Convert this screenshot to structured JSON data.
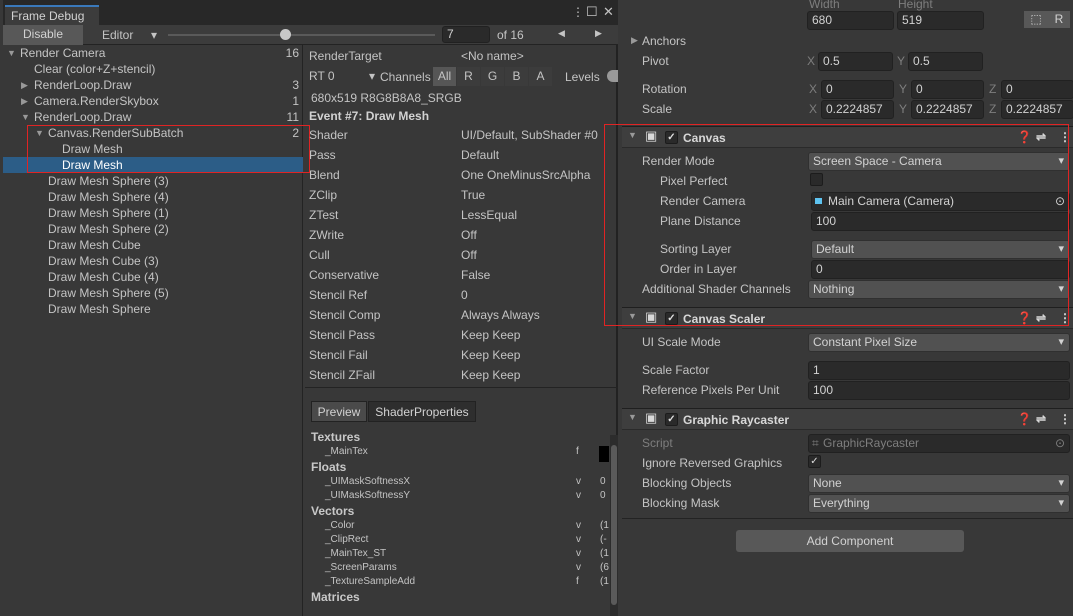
{
  "frame_debug": {
    "tab": "Frame Debug",
    "disable": "Disable",
    "target": "Editor",
    "event_index": "7",
    "of": "of 16",
    "slider_value": 7,
    "slider_max": 16,
    "tree": [
      {
        "label": "Render Camera",
        "count": "16",
        "indent": 0,
        "arrow": "▼"
      },
      {
        "label": "Clear (color+Z+stencil)",
        "count": "",
        "indent": 1,
        "arrow": ""
      },
      {
        "label": "RenderLoop.Draw",
        "count": "3",
        "indent": 1,
        "arrow": "▶"
      },
      {
        "label": "Camera.RenderSkybox",
        "count": "1",
        "indent": 1,
        "arrow": "▶"
      },
      {
        "label": "RenderLoop.Draw",
        "count": "11",
        "indent": 1,
        "arrow": "▼"
      },
      {
        "label": "Canvas.RenderSubBatch",
        "count": "2",
        "indent": 2,
        "arrow": "▼"
      },
      {
        "label": "Draw Mesh",
        "count": "",
        "indent": 3,
        "arrow": ""
      },
      {
        "label": "Draw Mesh",
        "count": "",
        "indent": 3,
        "arrow": "",
        "selected": true
      },
      {
        "label": "Draw Mesh Sphere (3)",
        "count": "",
        "indent": 2,
        "arrow": ""
      },
      {
        "label": "Draw Mesh Sphere (4)",
        "count": "",
        "indent": 2,
        "arrow": ""
      },
      {
        "label": "Draw Mesh Sphere (1)",
        "count": "",
        "indent": 2,
        "arrow": ""
      },
      {
        "label": "Draw Mesh Sphere (2)",
        "count": "",
        "indent": 2,
        "arrow": ""
      },
      {
        "label": "Draw Mesh Cube",
        "count": "",
        "indent": 2,
        "arrow": ""
      },
      {
        "label": "Draw Mesh Cube (3)",
        "count": "",
        "indent": 2,
        "arrow": ""
      },
      {
        "label": "Draw Mesh Cube (4)",
        "count": "",
        "indent": 2,
        "arrow": ""
      },
      {
        "label": "Draw Mesh Sphere (5)",
        "count": "",
        "indent": 2,
        "arrow": ""
      },
      {
        "label": "Draw Mesh Sphere",
        "count": "",
        "indent": 2,
        "arrow": ""
      }
    ],
    "render_target_label": "RenderTarget",
    "render_target": "<No name>",
    "rt": "RT 0",
    "channels": "Channels",
    "channel_buttons": [
      "All",
      "R",
      "G",
      "B",
      "A"
    ],
    "levels": "Levels",
    "format": "680x519 R8G8B8A8_SRGB",
    "event": "Event #7: Draw Mesh",
    "props": [
      [
        "Shader",
        "UI/Default, SubShader #0"
      ],
      [
        "Pass",
        "Default"
      ],
      [
        "Blend",
        "One OneMinusSrcAlpha"
      ],
      [
        "ZClip",
        "True"
      ],
      [
        "ZTest",
        "LessEqual"
      ],
      [
        "ZWrite",
        "Off"
      ],
      [
        "Cull",
        "Off"
      ],
      [
        "Conservative",
        "False"
      ],
      [
        "Stencil Ref",
        "0"
      ],
      [
        "Stencil Comp",
        "Always Always"
      ],
      [
        "Stencil Pass",
        "Keep Keep"
      ],
      [
        "Stencil Fail",
        "Keep Keep"
      ],
      [
        "Stencil ZFail",
        "Keep Keep"
      ]
    ],
    "tabs": [
      "Preview",
      "ShaderProperties"
    ],
    "shader_props": [
      {
        "section": "Textures"
      },
      {
        "name": "_MainTex",
        "type": "f",
        "value": ""
      },
      {
        "section": "Floats"
      },
      {
        "name": "_UIMaskSoftnessX",
        "type": "v",
        "value": "0"
      },
      {
        "name": "_UIMaskSoftnessY",
        "type": "v",
        "value": "0"
      },
      {
        "section": "Vectors"
      },
      {
        "name": "_Color",
        "type": "v",
        "value": "(1"
      },
      {
        "name": "_ClipRect",
        "type": "v",
        "value": "(-"
      },
      {
        "name": "_MainTex_ST",
        "type": "v",
        "value": "(1"
      },
      {
        "name": "_ScreenParams",
        "type": "v",
        "value": "(6"
      },
      {
        "name": "_TextureSampleAdd",
        "type": "f",
        "value": "(1"
      },
      {
        "section": "Matrices"
      }
    ]
  },
  "inspector": {
    "width_label": "Width",
    "height_label": "Height",
    "width": "680",
    "height": "519",
    "r_button": "R",
    "anchors": "Anchors",
    "pivot": {
      "label": "Pivot",
      "x": "0.5",
      "y": "0.5"
    },
    "rotation": {
      "label": "Rotation",
      "x": "0",
      "y": "0",
      "z": "0"
    },
    "scale": {
      "label": "Scale",
      "x": "0.2224857",
      "y": "0.2224857",
      "z": "0.2224857"
    },
    "axis": [
      "X",
      "Y",
      "Z"
    ],
    "canvas": {
      "title": "Canvas",
      "render_mode_label": "Render Mode",
      "render_mode": "Screen Space - Camera",
      "pixel_perfect": "Pixel Perfect",
      "render_camera_label": "Render Camera",
      "render_camera": "Main Camera (Camera)",
      "plane_distance_label": "Plane Distance",
      "plane_distance": "100",
      "sorting_layer_label": "Sorting Layer",
      "sorting_layer": "Default",
      "order_label": "Order in Layer",
      "order": "0",
      "shader_channels_label": "Additional Shader Channels",
      "shader_channels": "Nothing"
    },
    "scaler": {
      "title": "Canvas Scaler",
      "mode_label": "UI Scale Mode",
      "mode": "Constant Pixel Size",
      "factor_label": "Scale Factor",
      "factor": "1",
      "ppu_label": "Reference Pixels Per Unit",
      "ppu": "100"
    },
    "raycaster": {
      "title": "Graphic Raycaster",
      "script_label": "Script",
      "script": "GraphicRaycaster",
      "ignore_label": "Ignore Reversed Graphics",
      "ignore": true,
      "blocking_objects_label": "Blocking Objects",
      "blocking_objects": "None",
      "blocking_mask_label": "Blocking Mask",
      "blocking_mask": "Everything"
    },
    "add_component": "Add Component"
  },
  "colors": {
    "selection": "#2c5d87",
    "highlight_box": "#e02424",
    "tab_accent": "#3a79bb"
  }
}
